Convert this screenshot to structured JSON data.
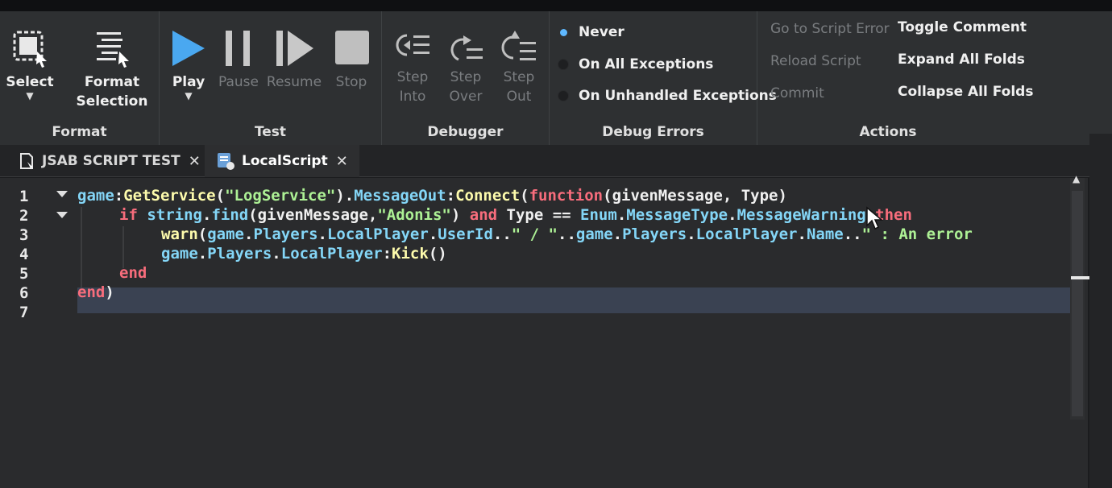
{
  "ribbon": {
    "groups": {
      "format": "Format",
      "test": "Test",
      "debugger": "Debugger",
      "debug_errors": "Debug Errors",
      "actions": "Actions"
    },
    "tools": {
      "select": "Select",
      "format_selection": "Format\nSelection",
      "play": "Play",
      "pause": "Pause",
      "resume": "Resume",
      "stop": "Stop",
      "step_into": "Step\nInto",
      "step_over": "Step\nOver",
      "step_out": "Step\nOut"
    },
    "debug_errors": {
      "never": "Never",
      "on_all": "On All Exceptions",
      "on_unhandled": "On Unhandled Exceptions",
      "selected": "Never"
    },
    "actions": {
      "go_to_error": "Go to Script Error",
      "reload": "Reload Script",
      "commit": "Commit",
      "toggle_comment": "Toggle Comment",
      "expand_folds": "Expand All Folds",
      "collapse_folds": "Collapse All Folds"
    }
  },
  "tabs": [
    {
      "label": "JSAB SCRIPT TEST",
      "active": false
    },
    {
      "label": "LocalScript",
      "active": true
    }
  ],
  "editor": {
    "line_numbers": [
      "1",
      "2",
      "3",
      "4",
      "5",
      "6",
      "7"
    ],
    "code": {
      "l1": {
        "a": "game",
        "b": ":",
        "c": "GetService",
        "d": "(",
        "e": "\"LogService\"",
        "f": ").",
        "g": "MessageOut",
        "h": ":",
        "i": "Connect",
        "j": "(",
        "k": "function",
        "l": "(givenMessage, Type)"
      },
      "l2": {
        "a": "if",
        "b": " ",
        "c": "string",
        "d": ".",
        "e": "find",
        "f": "(givenMessage,",
        "g": "\"Adonis\"",
        "h": ") ",
        "i": "and",
        "j": " Type == ",
        "k": "Enum",
        "l": ".",
        "m": "MessageType",
        "n": ".",
        "o": "MessageWarning",
        "p": " ",
        "q": "then"
      },
      "l3": {
        "a": "warn",
        "b": "(",
        "c": "game",
        "d": ".",
        "e": "Players",
        "f": ".",
        "g": "LocalPlayer",
        "h": ".",
        "i": "UserId",
        "j": "..",
        "k": "\" / \"",
        "l": "..",
        "m": "game",
        "n": ".",
        "o": "Players",
        "p": ".",
        "q": "LocalPlayer",
        "r": ".",
        "s": "Name",
        "t": "..",
        "u": "\" : An error"
      },
      "l4": {
        "a": "game",
        "b": ".",
        "c": "Players",
        "d": ".",
        "e": "LocalPlayer",
        "f": ":",
        "g": "Kick",
        "h": "()"
      },
      "l5": {
        "a": "end"
      },
      "l6": {
        "a": "end",
        "b": ")"
      }
    }
  },
  "colors": {
    "keyword": "#f86d7c",
    "function": "#fdfbac",
    "identifier": "#84d6f7",
    "string": "#adf195",
    "accent": "#5fb8ff",
    "play": "#4aa8f0"
  }
}
